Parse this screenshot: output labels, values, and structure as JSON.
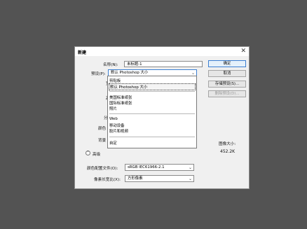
{
  "dialog": {
    "title": "新建",
    "close_glyph": "✕"
  },
  "form": {
    "name_label": "名称(N):",
    "name_value": "未标题-1",
    "preset_label": "预设(P):",
    "preset_value": "默认 Photoshop 大小",
    "partial_labels": [
      "宽",
      "高",
      "分",
      "颜色",
      "背景"
    ],
    "advanced_label": "高级",
    "color_profile_label": "颜色配置文件(O):",
    "color_profile_value": "sRGB IEC61966-2.1",
    "pixel_aspect_label": "像素长宽比(X):",
    "pixel_aspect_value": "方形像素"
  },
  "dropdown": {
    "items": [
      "剪贴板",
      "默认 Photoshop 大小",
      "美国标准纸张",
      "国际标准纸张",
      "照片",
      "Web",
      "移动设备",
      "胶片和视频",
      "自定"
    ],
    "selected_index": 1
  },
  "buttons": {
    "ok": "确定",
    "cancel": "取消",
    "save_preset": "存储预设(S)...",
    "delete_preset": "删除预设(D)..."
  },
  "image_size": {
    "label": "图像大小:",
    "value": "452.2K"
  }
}
